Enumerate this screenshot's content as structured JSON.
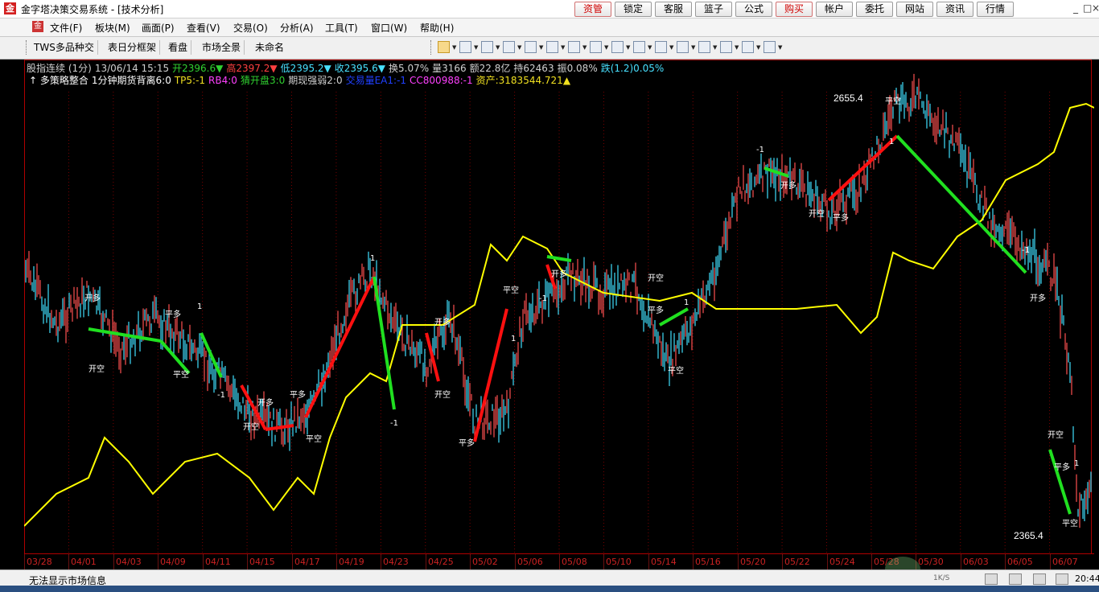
{
  "window": {
    "icon": "金",
    "title": "金字塔决策交易系统 - [技术分析]",
    "controls": [
      "_",
      "□",
      "×"
    ]
  },
  "top_buttons": [
    {
      "label": "资管",
      "accent": true
    },
    {
      "label": "锁定",
      "accent": false
    },
    {
      "label": "客服",
      "accent": false
    },
    {
      "label": "篮子",
      "accent": false
    },
    {
      "label": "公式",
      "accent": false
    },
    {
      "label": "购买",
      "accent": true
    },
    {
      "label": "帐户",
      "accent": false
    },
    {
      "label": "委托",
      "accent": false
    },
    {
      "label": "网站",
      "accent": false
    },
    {
      "label": "资讯",
      "accent": false
    },
    {
      "label": "行情",
      "accent": false
    }
  ],
  "menu": {
    "icon": "金",
    "items": [
      "文件(F)",
      "板块(M)",
      "画面(P)",
      "查看(V)",
      "交易(O)",
      "分析(A)",
      "工具(T)",
      "窗口(W)",
      "帮助(H)"
    ]
  },
  "tabs": [
    "TWS多品种交",
    "表日分框架",
    "看盘",
    "市场全景",
    "未命名"
  ],
  "toolbar_icons": [
    "cursor-icon",
    "line-tool-icon",
    "text-tool-icon",
    "vertical-lines-icon",
    "channel-icon",
    "fibonacci-icon",
    "gann-icon",
    "rectangle-icon",
    "circle-icon",
    "label-a-icon",
    "zoom-icon",
    "delete-icon",
    "eraser-icon",
    "copy-icon",
    "color-grid-icon",
    "layers-icon"
  ],
  "chart": {
    "info_line1": [
      {
        "text": "股指连续 (1分)",
        "color": "grey"
      },
      {
        "text": "13/06/14 15:15",
        "color": "grey"
      },
      {
        "text": "开2396.6▼",
        "color": "green"
      },
      {
        "text": "高2397.2▼",
        "color": "red"
      },
      {
        "text": "低2395.2▼",
        "color": "cyan"
      },
      {
        "text": "收2395.6▼",
        "color": "cyan"
      },
      {
        "text": "换5.07%",
        "color": "grey"
      },
      {
        "text": "量3166",
        "color": "grey"
      },
      {
        "text": "额22.8亿",
        "color": "grey"
      },
      {
        "text": "持62463",
        "color": "grey"
      },
      {
        "text": "振0.08%",
        "color": "grey"
      },
      {
        "text": "跌(1.2)0.05%",
        "color": "cyan"
      }
    ],
    "info_line2": [
      {
        "text": "↑ 多策略整合",
        "color": "white"
      },
      {
        "text": "1分钟期货背离6:0",
        "color": "white"
      },
      {
        "text": "TP5:-1",
        "color": "yellow"
      },
      {
        "text": "RB4:0",
        "color": "mag"
      },
      {
        "text": "猜开盘3:0",
        "color": "green"
      },
      {
        "text": "期现强弱2:0",
        "color": "grey"
      },
      {
        "text": "交易量EA1:-1",
        "color": "blue"
      },
      {
        "text": "CC800988:-1",
        "color": "mag"
      },
      {
        "text": "资产:3183544.721▲",
        "color": "yellow"
      }
    ],
    "high_label": "2655.4",
    "low_label": "2365.4",
    "signal_labels": [
      "开多",
      "开空",
      "平多",
      "平空",
      "1",
      "-1"
    ],
    "dates": [
      "03/28",
      "04/01",
      "04/03",
      "04/09",
      "04/11",
      "04/15",
      "04/17",
      "04/19",
      "04/23",
      "04/25",
      "05/02",
      "05/06",
      "05/08",
      "05/10",
      "05/14",
      "05/16",
      "05/20",
      "05/22",
      "05/24",
      "05/28",
      "05/30",
      "06/03",
      "06/05",
      "06/07"
    ],
    "colors": {
      "up": "#ff5050",
      "down": "#40e0ff",
      "equity": "#ffff00",
      "long_trade": "#ff1010",
      "short_trade": "#20e020",
      "grid": "#7a0000"
    }
  },
  "status": {
    "message": "无法显示市场信息",
    "speed": "1K/S",
    "time": "20:44"
  }
}
